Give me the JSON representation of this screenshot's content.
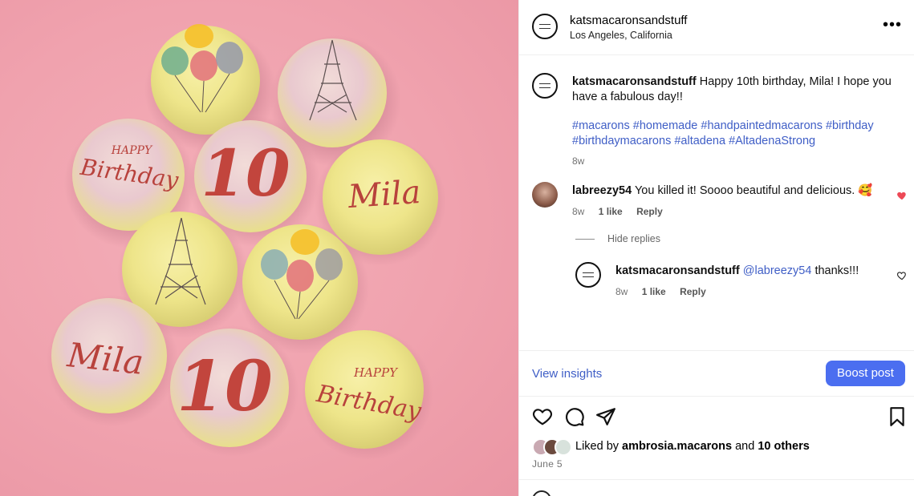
{
  "photo": {
    "macaron_texts": {
      "happy": "HAPPY",
      "birthday": "Birthday",
      "ten": "10",
      "name": "Mila"
    }
  },
  "header": {
    "username": "katsmacaronsandstuff",
    "location": "Los Angeles, California",
    "more_icon": "more-horizontal-icon"
  },
  "caption": {
    "username": "katsmacaronsandstuff",
    "text": "Happy 10th birthday, Mila! I hope you have a fabulous day!!",
    "hashtags_line1": "#macarons #homemade #handpaintedmacarons #birthday",
    "hashtags_line2": "#birthdaymacarons #altadena #AltadenaStrong",
    "time": "8w"
  },
  "comment1": {
    "username": "labreezy54",
    "text": "You killed it! Soooo beautiful and delicious. 🥰",
    "time": "8w",
    "likes": "1 like",
    "reply": "Reply",
    "liked_color": "#ed4956"
  },
  "hide_replies": "Hide replies",
  "reply1": {
    "username": "katsmacaronsandstuff",
    "mention": "@labreezy54",
    "text": "thanks!!!",
    "time": "8w",
    "likes": "1 like",
    "reply": "Reply"
  },
  "insights": {
    "view_label": "View insights",
    "boost_label": "Boost post",
    "boost_color": "#4b6ef0"
  },
  "likes_row": {
    "prefix": "Liked by",
    "user": "ambrosia.macarons",
    "middle": "and",
    "others": "10 others"
  },
  "date": "June 5"
}
